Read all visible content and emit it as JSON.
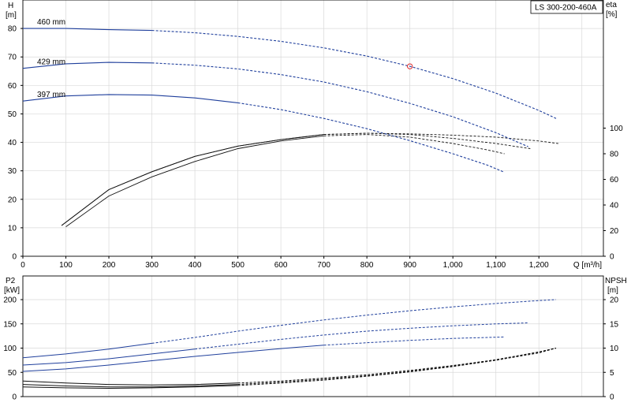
{
  "model_label": "LS 300-200-460A",
  "chart_data": [
    {
      "type": "line",
      "panel": "head_and_efficiency",
      "xlabel": "Q [m³/h]",
      "xlim": [
        0,
        1350
      ],
      "x_ticks": [
        "0",
        "100",
        "200",
        "300",
        "400",
        "500",
        "600",
        "700",
        "800",
        "900",
        "1,000",
        "1,100",
        "1,200"
      ],
      "y_axis_left": {
        "label_1": "H",
        "label_2": "[m]",
        "lim": [
          0,
          90
        ],
        "ticks": [
          "0",
          "10",
          "20",
          "30",
          "40",
          "50",
          "60",
          "70",
          "80"
        ]
      },
      "y_axis_right": {
        "label_1": "eta",
        "label_2": "[%]",
        "lim": [
          0,
          200
        ],
        "ticks": [
          "0",
          "20",
          "40",
          "60",
          "80",
          "100"
        ]
      },
      "grid": true,
      "head_curves": [
        {
          "name": "460 mm",
          "axis": "left",
          "solid_to_x": 300,
          "points": [
            [
              0,
              80
            ],
            [
              100,
              80
            ],
            [
              200,
              79.6
            ],
            [
              300,
              79.3
            ],
            [
              400,
              78.5
            ],
            [
              500,
              77.2
            ],
            [
              600,
              75.5
            ],
            [
              700,
              73.2
            ],
            [
              800,
              70.3
            ],
            [
              900,
              66.7
            ],
            [
              1000,
              62.4
            ],
            [
              1100,
              57.3
            ],
            [
              1200,
              51.2
            ],
            [
              1240,
              48.4
            ]
          ]
        },
        {
          "name": "429 mm",
          "axis": "left",
          "solid_to_x": 300,
          "points": [
            [
              0,
              66
            ],
            [
              100,
              67.6
            ],
            [
              200,
              68.1
            ],
            [
              300,
              67.9
            ],
            [
              400,
              67.1
            ],
            [
              500,
              65.8
            ],
            [
              600,
              63.8
            ],
            [
              700,
              61.2
            ],
            [
              800,
              57.8
            ],
            [
              900,
              53.7
            ],
            [
              1000,
              49
            ],
            [
              1100,
              43.4
            ],
            [
              1175,
              38.5
            ]
          ]
        },
        {
          "name": "397 mm",
          "axis": "left",
          "solid_to_x": 500,
          "points": [
            [
              0,
              54.5
            ],
            [
              100,
              56.3
            ],
            [
              200,
              56.8
            ],
            [
              300,
              56.6
            ],
            [
              400,
              55.6
            ],
            [
              500,
              53.9
            ],
            [
              600,
              51.5
            ],
            [
              700,
              48.4
            ],
            [
              800,
              44.8
            ],
            [
              900,
              40.6
            ],
            [
              1000,
              36
            ],
            [
              1080,
              32
            ],
            [
              1120,
              29.5
            ]
          ]
        }
      ],
      "efficiency_curves": [
        {
          "axis": "right",
          "solid_to_x": 700,
          "points": [
            [
              90,
              24
            ],
            [
              200,
              52
            ],
            [
              300,
              66
            ],
            [
              400,
              78
            ],
            [
              500,
              86
            ],
            [
              600,
              91
            ],
            [
              700,
              95
            ],
            [
              800,
              96
            ],
            [
              900,
              95.5
            ],
            [
              1000,
              94.5
            ],
            [
              1100,
              93
            ],
            [
              1200,
              90
            ],
            [
              1245,
              88
            ]
          ]
        },
        {
          "axis": "right",
          "solid_to_x": 700,
          "points": [
            [
              90,
              24
            ],
            [
              200,
              52
            ],
            [
              300,
              66
            ],
            [
              400,
              78
            ],
            [
              500,
              86
            ],
            [
              600,
              91
            ],
            [
              700,
              95
            ],
            [
              800,
              96
            ],
            [
              900,
              95
            ],
            [
              1000,
              92
            ],
            [
              1100,
              88
            ],
            [
              1180,
              84
            ]
          ]
        },
        {
          "axis": "right",
          "solid_to_x": 700,
          "points": [
            [
              100,
              23
            ],
            [
              200,
              47
            ],
            [
              300,
              62
            ],
            [
              400,
              74
            ],
            [
              500,
              84
            ],
            [
              600,
              90
            ],
            [
              700,
              94
            ],
            [
              800,
              95
            ],
            [
              900,
              93
            ],
            [
              1000,
              88
            ],
            [
              1080,
              83
            ],
            [
              1120,
              80
            ]
          ]
        }
      ],
      "duty_point": {
        "x": 900,
        "y": 66.7,
        "color": "#e03030"
      }
    },
    {
      "type": "line",
      "panel": "power_and_npsh",
      "xlim": [
        0,
        1350
      ],
      "y_axis_left": {
        "label_1": "P2",
        "label_2": "[kW]",
        "lim": [
          0,
          200
        ],
        "ticks": [
          "0",
          "50",
          "100",
          "150",
          "200"
        ]
      },
      "y_axis_right": {
        "label_1": "NPSH",
        "label_2": "[m]",
        "lim": [
          0,
          20
        ],
        "ticks": [
          "0",
          "5",
          "10",
          "15",
          "20"
        ]
      },
      "grid": true,
      "power_curves": [
        {
          "axis": "left",
          "solid_to_x": 300,
          "points": [
            [
              0,
              80
            ],
            [
              100,
              88
            ],
            [
              200,
              98
            ],
            [
              300,
              110
            ],
            [
              400,
              122
            ],
            [
              500,
              135
            ],
            [
              600,
              147
            ],
            [
              700,
              158
            ],
            [
              800,
              168
            ],
            [
              900,
              177
            ],
            [
              1000,
              185
            ],
            [
              1100,
              192
            ],
            [
              1200,
              198
            ],
            [
              1240,
              200
            ]
          ]
        },
        {
          "axis": "left",
          "solid_to_x": 400,
          "points": [
            [
              0,
              65
            ],
            [
              100,
              70
            ],
            [
              200,
              78
            ],
            [
              300,
              88
            ],
            [
              400,
              98
            ],
            [
              500,
              108
            ],
            [
              600,
              118
            ],
            [
              700,
              127
            ],
            [
              800,
              135
            ],
            [
              900,
              141
            ],
            [
              1000,
              146
            ],
            [
              1100,
              150
            ],
            [
              1175,
              152
            ]
          ]
        },
        {
          "axis": "left",
          "solid_to_x": 700,
          "points": [
            [
              0,
              52
            ],
            [
              100,
              57
            ],
            [
              200,
              65
            ],
            [
              300,
              74
            ],
            [
              400,
              83
            ],
            [
              500,
              91
            ],
            [
              600,
              99
            ],
            [
              700,
              106
            ],
            [
              800,
              111
            ],
            [
              900,
              116
            ],
            [
              1000,
              120
            ],
            [
              1080,
              122
            ],
            [
              1120,
              123
            ]
          ]
        }
      ],
      "npsh_curves": [
        {
          "axis": "right",
          "solid_to_x": 500,
          "points": [
            [
              0,
              3.2
            ],
            [
              100,
              2.8
            ],
            [
              200,
              2.5
            ],
            [
              300,
              2.4
            ],
            [
              400,
              2.5
            ],
            [
              500,
              2.8
            ],
            [
              600,
              3.2
            ],
            [
              700,
              3.8
            ],
            [
              800,
              4.5
            ],
            [
              900,
              5.4
            ],
            [
              1000,
              6.4
            ],
            [
              1100,
              7.6
            ],
            [
              1200,
              9.2
            ],
            [
              1240,
              10
            ]
          ]
        },
        {
          "axis": "right",
          "solid_to_x": 500,
          "points": [
            [
              0,
              2.5
            ],
            [
              100,
              2.2
            ],
            [
              200,
              2
            ],
            [
              300,
              2
            ],
            [
              400,
              2.2
            ],
            [
              500,
              2.5
            ],
            [
              600,
              3
            ],
            [
              700,
              3.6
            ],
            [
              800,
              4.3
            ],
            [
              900,
              5.2
            ],
            [
              1000,
              6.3
            ],
            [
              1100,
              7.6
            ],
            [
              1200,
              9.2
            ],
            [
              1240,
              10
            ]
          ]
        },
        {
          "axis": "right",
          "solid_to_x": 500,
          "points": [
            [
              0,
              2
            ],
            [
              100,
              1.8
            ],
            [
              200,
              1.7
            ],
            [
              300,
              1.8
            ],
            [
              400,
              2
            ],
            [
              500,
              2.3
            ],
            [
              600,
              2.8
            ],
            [
              700,
              3.4
            ],
            [
              800,
              4.2
            ],
            [
              900,
              5.1
            ],
            [
              1000,
              6.2
            ],
            [
              1100,
              7.5
            ],
            [
              1200,
              9
            ],
            [
              1240,
              10
            ]
          ]
        }
      ]
    }
  ],
  "colors": {
    "blue": "#1f3f9c",
    "black": "#111111",
    "grid": "#d9d9d9",
    "frame": "#000000",
    "red": "#e03030"
  }
}
